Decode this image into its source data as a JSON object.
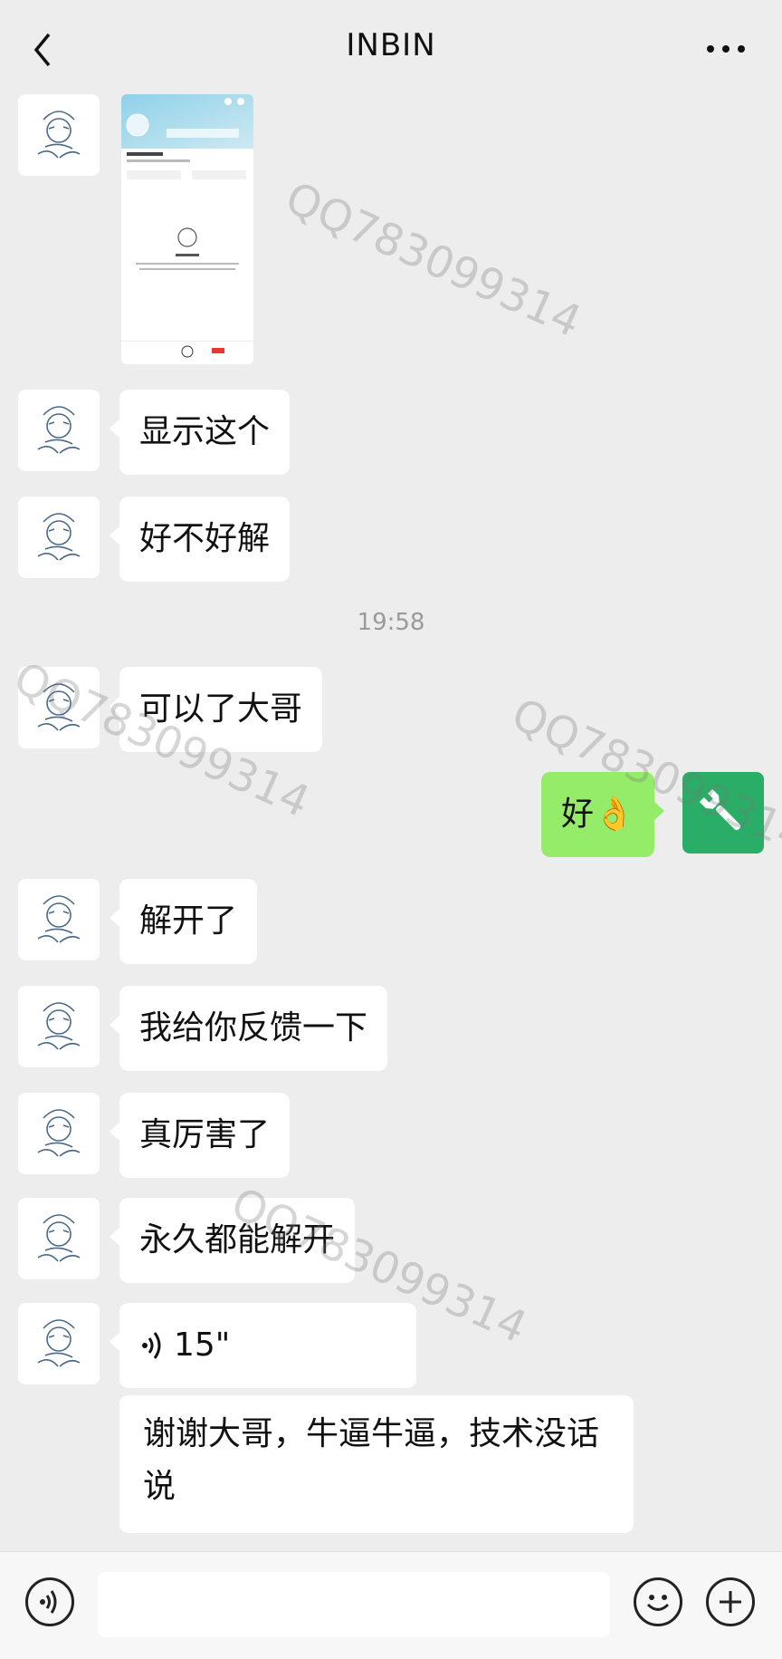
{
  "header": {
    "title": "INBIN"
  },
  "icons": {
    "back": "chevron-left-icon",
    "more": "more-dots-icon",
    "voice": "voice-icon",
    "emoji": "emoji-face-icon",
    "add": "plus-circle-icon",
    "self_avatar": "wrench-icon"
  },
  "colors": {
    "background": "#ededed",
    "self_bubble": "#95ec69",
    "self_avatar": "#2aae67"
  },
  "messages": [
    {
      "text": "显示这个"
    },
    {
      "text": "好不好解"
    },
    {
      "text": "可以了大哥"
    },
    {
      "text": "好👌"
    },
    {
      "text": "解开了"
    },
    {
      "text": "我给你反馈一下"
    },
    {
      "text": "真厉害了"
    },
    {
      "text": "永久都能解开"
    },
    {
      "text": "15\""
    },
    {
      "text": "谢谢大哥，牛逼牛逼，技术没话说"
    }
  ],
  "timestamp": "19:58",
  "watermark": "QQ783099314"
}
